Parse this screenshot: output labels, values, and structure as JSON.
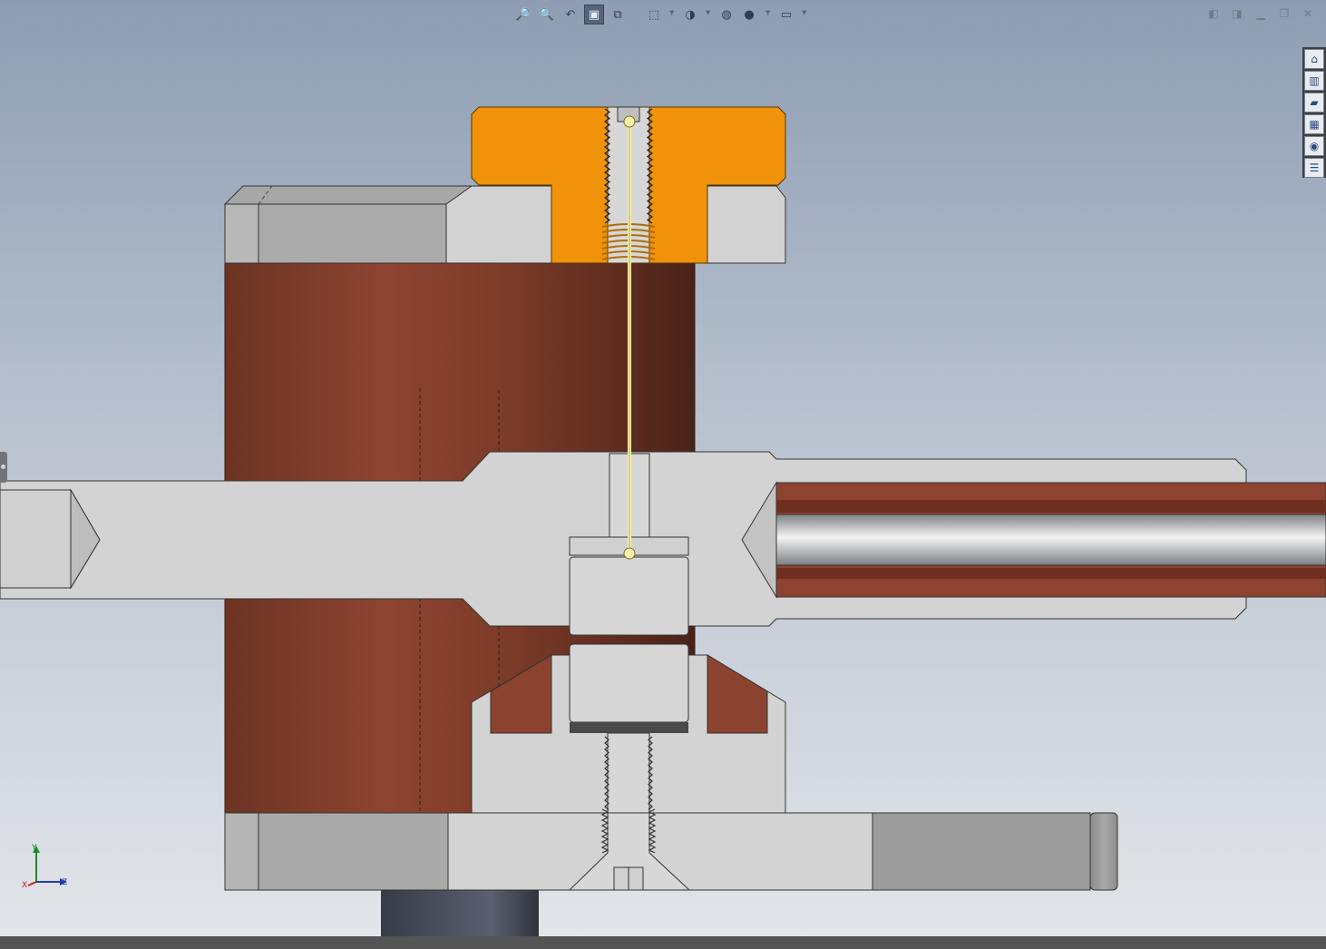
{
  "toolbar": {
    "items": [
      {
        "name": "zoom-to-fit",
        "glyph": "🔎"
      },
      {
        "name": "zoom-to-area",
        "glyph": "🔍"
      },
      {
        "name": "previous-view",
        "glyph": "↶"
      },
      {
        "name": "section-view",
        "glyph": "▣",
        "active": true
      },
      {
        "name": "dynamic-annotation-views",
        "glyph": "⧉"
      },
      {
        "name": "view-orientation",
        "glyph": "⬚"
      },
      {
        "name": "display-style",
        "glyph": "◑"
      },
      {
        "name": "hide-show-items",
        "glyph": "◍"
      },
      {
        "name": "edit-appearance",
        "glyph": "●"
      },
      {
        "name": "view-settings",
        "glyph": "▭"
      }
    ]
  },
  "task_pane": [
    {
      "name": "home",
      "glyph": "⌂"
    },
    {
      "name": "design-library",
      "glyph": "▥"
    },
    {
      "name": "file-explorer",
      "glyph": "▰"
    },
    {
      "name": "view-palette",
      "glyph": "▦"
    },
    {
      "name": "appearances",
      "glyph": "◉"
    },
    {
      "name": "custom-properties",
      "glyph": "☰"
    }
  ],
  "triad": {
    "x": "X",
    "y": "Y",
    "z": "Z"
  },
  "colors": {
    "copper": "#8b4330",
    "cap_orange": "#f0920a",
    "steel": "#d3d3d3",
    "seam": "#fbf3a8"
  }
}
